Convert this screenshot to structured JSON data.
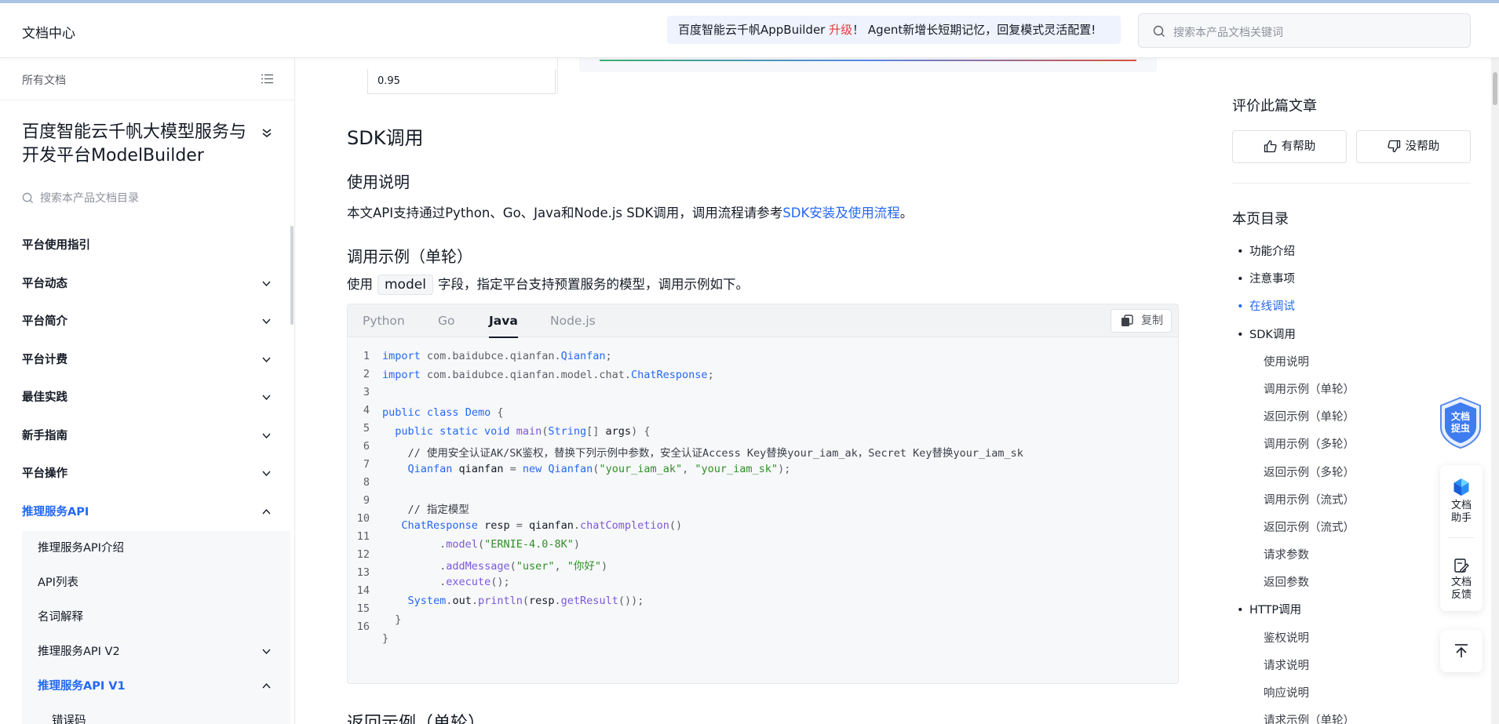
{
  "header": {
    "title": "文档中心",
    "announcement_prefix": "百度智能云千帆AppBuilder ",
    "announcement_highlight": "升级",
    "announcement_suffix": "！ Agent新增长短期记忆，回复模式灵活配置!",
    "search_placeholder": "搜索本产品文档关键词"
  },
  "sidebar": {
    "all_docs": "所有文档",
    "product_title": "百度智能云千帆大模型服务与开发平台ModelBuilder",
    "search_placeholder": "搜索本产品文档目录",
    "items": [
      {
        "label": "平台使用指引"
      },
      {
        "label": "平台动态"
      },
      {
        "label": "平台简介"
      },
      {
        "label": "平台计费"
      },
      {
        "label": "最佳实践"
      },
      {
        "label": "新手指南"
      },
      {
        "label": "平台操作"
      },
      {
        "label": "推理服务API"
      }
    ],
    "sub_items": [
      {
        "label": "推理服务API介绍"
      },
      {
        "label": "API列表"
      },
      {
        "label": "名词解释"
      },
      {
        "label": "推理服务API V2"
      },
      {
        "label": "推理服务API V1"
      },
      {
        "label": "错误码"
      }
    ]
  },
  "form_peek": {
    "value": "0.95"
  },
  "content": {
    "h2_sdk": "SDK调用",
    "h3_usage": "使用说明",
    "usage_text": "本文API支持通过Python、Go、Java和Node.js SDK调用，调用流程请参考",
    "usage_link": "SDK安装及使用流程",
    "usage_end": "。",
    "h3_example": "调用示例（单轮）",
    "example_pre": "使用",
    "example_code": "model",
    "example_post": "字段，指定平台支持预置服务的模型，调用示例如下。",
    "h3_next": "返回示例（单轮）"
  },
  "code": {
    "tabs": [
      "Python",
      "Go",
      "Java",
      "Node.js"
    ],
    "active_tab": "Java",
    "copy_label": "复制",
    "line_numbers": [
      "1",
      "2",
      "3",
      "4",
      "5",
      "6",
      "7",
      "8",
      "9",
      "10",
      "11",
      "12",
      "13",
      "14",
      "15",
      "16"
    ]
  },
  "right": {
    "rate_title": "评价此篇文章",
    "helpful": "有帮助",
    "not_helpful": "没帮助",
    "toc_title": "本页目录",
    "toc": [
      {
        "label": "功能介绍",
        "level": 1
      },
      {
        "label": "注意事项",
        "level": 1
      },
      {
        "label": "在线调试",
        "level": 1
      },
      {
        "label": "SDK调用",
        "level": 1
      },
      {
        "label": "使用说明",
        "level": 2
      },
      {
        "label": "调用示例（单轮）",
        "level": 2
      },
      {
        "label": "返回示例（单轮）",
        "level": 2
      },
      {
        "label": "调用示例（多轮）",
        "level": 2
      },
      {
        "label": "返回示例（多轮）",
        "level": 2
      },
      {
        "label": "调用示例（流式）",
        "level": 2
      },
      {
        "label": "返回示例（流式）",
        "level": 2
      },
      {
        "label": "请求参数",
        "level": 2
      },
      {
        "label": "返回参数",
        "level": 2
      },
      {
        "label": "HTTP调用",
        "level": 1
      },
      {
        "label": "鉴权说明",
        "level": 2
      },
      {
        "label": "请求说明",
        "level": 2
      },
      {
        "label": "响应说明",
        "level": 2
      },
      {
        "label": "请求示例（单轮）",
        "level": 2
      }
    ]
  },
  "widgets": {
    "bug_badge_line1": "文档",
    "bug_badge_line2": "捉虫",
    "assistant_line1": "文档",
    "assistant_line2": "助手",
    "feedback_line1": "文档",
    "feedback_line2": "反馈"
  },
  "colors": {
    "accent": "#2468f2",
    "highlight": "#e8393a"
  }
}
